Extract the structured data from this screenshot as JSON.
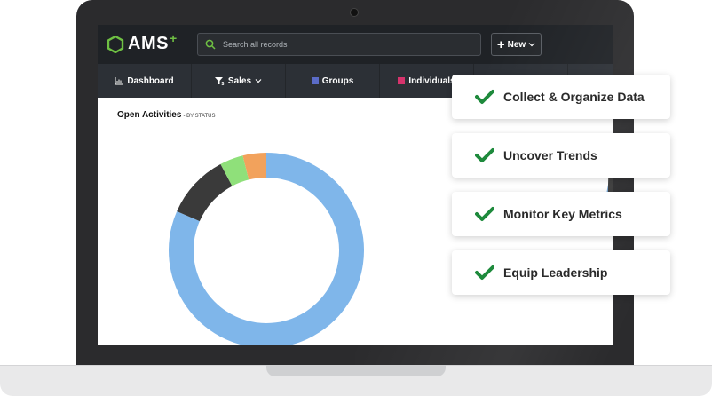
{
  "app": {
    "logo_text": "AMS",
    "logo_plus": "+",
    "brand_color": "#6fc043"
  },
  "search": {
    "placeholder": "Search all records",
    "icon": "search-icon"
  },
  "new_button": {
    "label": "New",
    "icon": "plus-icon"
  },
  "nav": {
    "items": [
      {
        "label": "Dashboard",
        "icon": "chart-icon"
      },
      {
        "label": "Sales",
        "icon": "funnel-icon"
      },
      {
        "label": "Groups",
        "icon": "square-icon",
        "color": "#5b6cc8"
      },
      {
        "label": "Individuals",
        "icon": "square-icon",
        "color": "#d6336c"
      }
    ]
  },
  "panel": {
    "title": "Open Activities",
    "subtitle": "- BY STATUS"
  },
  "chart_data": {
    "type": "pie",
    "values": [
      84,
      11,
      4,
      4
    ],
    "colors": [
      "#7fb6ea",
      "#3a3a3a",
      "#8fe07a",
      "#f2a25c"
    ]
  },
  "features": [
    {
      "label": "Collect & Organize Data"
    },
    {
      "label": "Uncover Trends"
    },
    {
      "label": "Monitor Key Metrics"
    },
    {
      "label": "Equip Leadership"
    }
  ],
  "colors": {
    "check": "#1e8a3c",
    "topbar": "#1f2226",
    "navbar": "#2c3036"
  }
}
